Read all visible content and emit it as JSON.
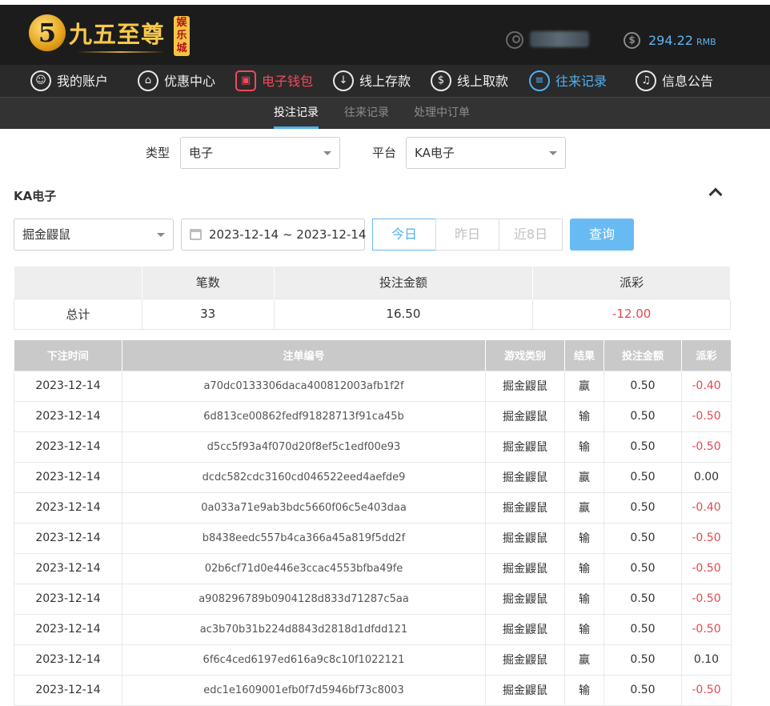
{
  "brand": {
    "name": "九五至尊",
    "badge": "娱乐城",
    "mark": "5"
  },
  "account": {
    "balance": "294.22",
    "currency": "RMB",
    "money_symbol": "$"
  },
  "nav": [
    {
      "label": "我的账户",
      "icon": "user-icon",
      "glyph": "☺"
    },
    {
      "label": "优惠中心",
      "icon": "gift-icon",
      "glyph": "⌂"
    },
    {
      "label": "电子钱包",
      "icon": "wallet-icon",
      "glyph": "▣"
    },
    {
      "label": "线上存款",
      "icon": "deposit-icon",
      "glyph": "↓"
    },
    {
      "label": "线上取款",
      "icon": "withdraw-icon",
      "glyph": "$"
    },
    {
      "label": "往来记录",
      "icon": "records-icon",
      "glyph": "≡"
    },
    {
      "label": "信息公告",
      "icon": "bell-icon",
      "glyph": "♫"
    }
  ],
  "subtabs": [
    "投注记录",
    "往来记录",
    "处理中订单"
  ],
  "filters": {
    "type_label": "类型",
    "type_value": "电子",
    "platform_label": "平台",
    "platform_value": "KA电子"
  },
  "section_title": "KA电子",
  "game_select": "掘金鼹鼠",
  "date_range": "2023-12-14 ~ 2023-12-14",
  "quick_ranges": [
    "今日",
    "昨日",
    "近8日"
  ],
  "query_label": "查询",
  "summary": {
    "headers": [
      "",
      "笔数",
      "投注金额",
      "派彩"
    ],
    "row": [
      "总计",
      "33",
      "16.50",
      "-12.00"
    ]
  },
  "records": {
    "headers": [
      "下注时间",
      "注单编号",
      "游戏类别",
      "结果",
      "投注金额",
      "派彩"
    ],
    "rows": [
      [
        "2023-12-14",
        "a70dc0133306daca400812003afb1f2f",
        "掘金鼹鼠",
        "赢",
        "0.50",
        "-0.40"
      ],
      [
        "2023-12-14",
        "6d813ce00862fedf91828713f91ca45b",
        "掘金鼹鼠",
        "输",
        "0.50",
        "-0.50"
      ],
      [
        "2023-12-14",
        "d5cc5f93a4f070d20f8ef5c1edf00e93",
        "掘金鼹鼠",
        "输",
        "0.50",
        "-0.50"
      ],
      [
        "2023-12-14",
        "dcdc582cdc3160cd046522eed4aefde9",
        "掘金鼹鼠",
        "赢",
        "0.50",
        "0.00"
      ],
      [
        "2023-12-14",
        "0a033a71e9ab3bdc5660f06c5e403daa",
        "掘金鼹鼠",
        "赢",
        "0.50",
        "-0.40"
      ],
      [
        "2023-12-14",
        "b8438eedc557b4ca366a45a819f5dd2f",
        "掘金鼹鼠",
        "输",
        "0.50",
        "-0.50"
      ],
      [
        "2023-12-14",
        "02b6cf71d0e446e3ccac4553bfba49fe",
        "掘金鼹鼠",
        "输",
        "0.50",
        "-0.50"
      ],
      [
        "2023-12-14",
        "a908296789b0904128d833d71287c5aa",
        "掘金鼹鼠",
        "输",
        "0.50",
        "-0.50"
      ],
      [
        "2023-12-14",
        "ac3b70b31b224d8843d2818d1dfdd121",
        "掘金鼹鼠",
        "输",
        "0.50",
        "-0.50"
      ],
      [
        "2023-12-14",
        "6f6c4ced6197ed616a9c8c10f1022121",
        "掘金鼹鼠",
        "赢",
        "0.50",
        "0.10"
      ],
      [
        "2023-12-14",
        "edc1e1609001efb0f7d5946bf73c8003",
        "掘金鼹鼠",
        "输",
        "0.50",
        "-0.50"
      ]
    ]
  },
  "colors": {
    "accent": "#4fb0ef",
    "negative": "#e5484d",
    "wallet_active": "#f2495a",
    "gold": "#f7c94a"
  }
}
